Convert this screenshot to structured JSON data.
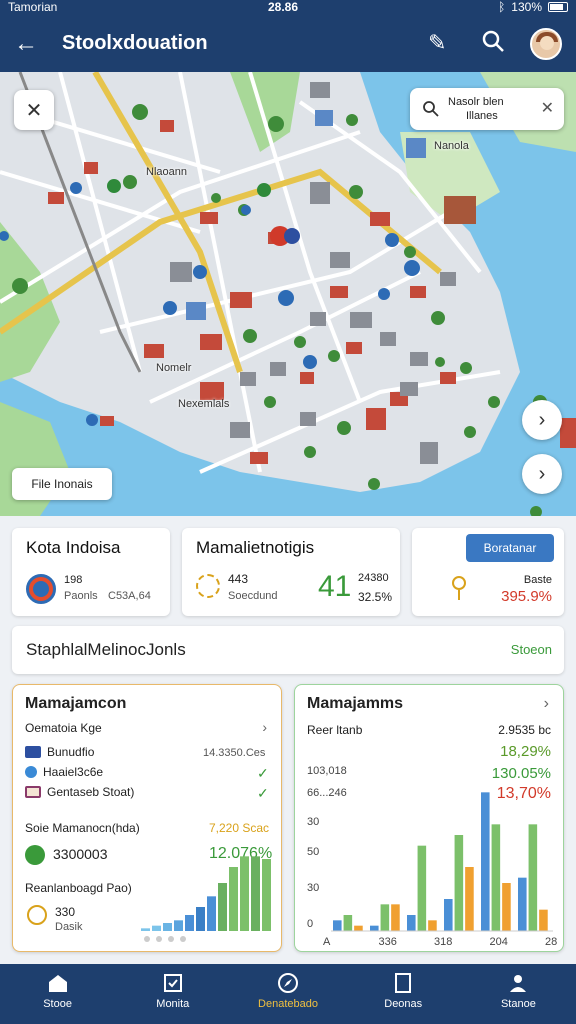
{
  "status": {
    "carrier": "Tamorian",
    "time": "28.86",
    "battery": "130%"
  },
  "appbar": {
    "title": "Stoolxdouation"
  },
  "map": {
    "search_line1": "Nasolr blen",
    "search_line2": "Illanes",
    "labels": {
      "l1": "Nanola",
      "l2": "Nlaoann",
      "l3": "Nomelr",
      "l4": "Nexemlals"
    },
    "file_button": "File Inonais"
  },
  "stats": {
    "card1": {
      "title": "Kota Indoisa",
      "value1": "198",
      "value2": "Paonls",
      "value3": "C53A,64"
    },
    "card2": {
      "title": "Mamalietnotigis",
      "value1": "443",
      "value2": "Soecdund",
      "big": "41",
      "value3": "24380",
      "value4": "32.5%"
    },
    "card3": {
      "button": "Boratanar",
      "value1": "Baste",
      "value2": "395.9%"
    }
  },
  "section": {
    "title": "StaphlalMelinocJonls",
    "link": "Stoeon"
  },
  "panel_left": {
    "title": "Mamajamcon",
    "subtitle": "Oematoia Kge",
    "rows": [
      {
        "label": "Bunudfio",
        "value": "14.3350.Ces"
      },
      {
        "label": "Haaiel3c6e",
        "value": ""
      },
      {
        "label": "Gentaseb Stoat)",
        "value": ""
      }
    ],
    "label1": "Soie Mamanocn(hda)",
    "pct1": "7,220 Scac",
    "number": "3300003",
    "pct2": "12.076%",
    "label2": "Reanlanboagd Pao)",
    "n2": "330",
    "n3": "Dasik",
    "mini_values": [
      1,
      2,
      3,
      4,
      6,
      9,
      13,
      18,
      24,
      28,
      28,
      27
    ]
  },
  "panel_right": {
    "title": "Mamajamms",
    "label": "Reer ltanb",
    "right_values": [
      "2.9535 bc",
      "18,29%",
      "130.05%",
      "13,70%"
    ],
    "right_colors": [
      "#222",
      "#5a9a2a",
      "#3a9a3a",
      "#d23a2a"
    ],
    "left_values": [
      "103,018",
      "66...246"
    ],
    "y_ticks": [
      "30",
      "50",
      "30",
      "0"
    ],
    "x_ticks": [
      "A",
      "336",
      "318",
      "204",
      "28"
    ],
    "chart_data": {
      "type": "bar",
      "series": [
        {
          "color": "#4a8fd6",
          "values": [
            2,
            1,
            3,
            6,
            26,
            10
          ]
        },
        {
          "color": "#7cc06a",
          "values": [
            3,
            5,
            16,
            18,
            20,
            20
          ]
        },
        {
          "color": "#f0a030",
          "values": [
            1,
            5,
            2,
            12,
            9,
            4
          ]
        }
      ],
      "ylim": [
        0,
        30
      ]
    }
  },
  "nav": [
    {
      "label": "Stooe"
    },
    {
      "label": "Monita"
    },
    {
      "label": "Denatebado"
    },
    {
      "label": "Deonas"
    },
    {
      "label": "Stanoe"
    }
  ]
}
